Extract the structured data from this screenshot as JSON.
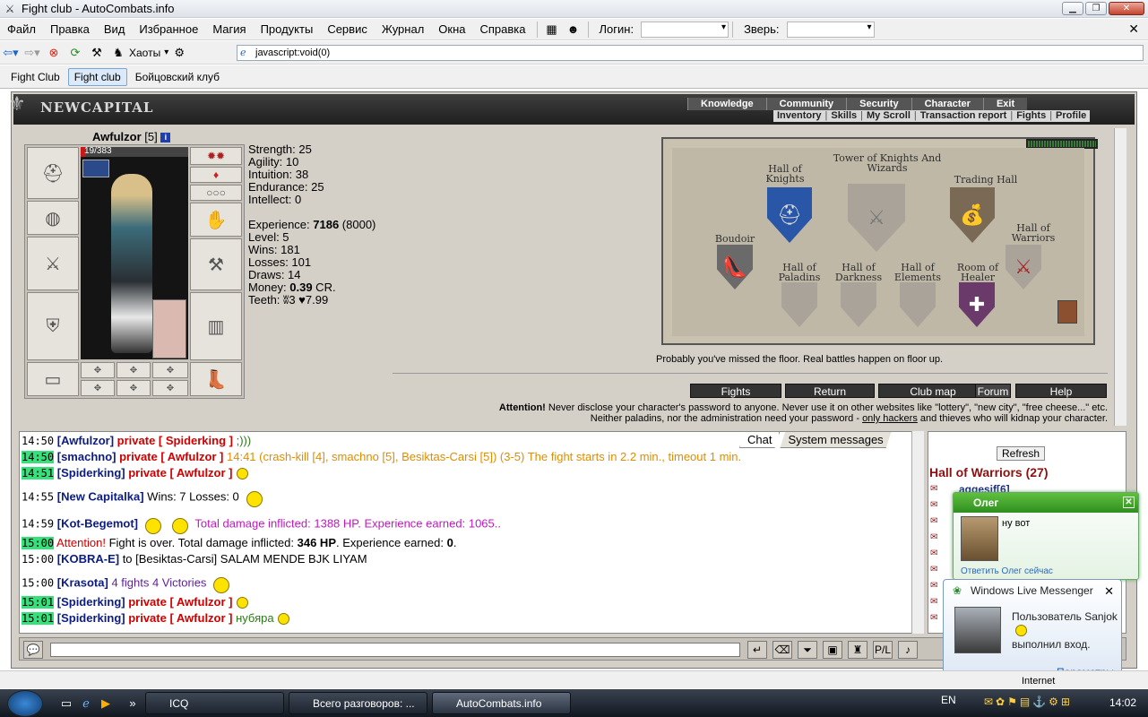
{
  "window": {
    "title": "Fight club - AutoCombats.info"
  },
  "menu": {
    "items": [
      "Файл",
      "Правка",
      "Вид",
      "Избранное",
      "Магия",
      "Продукты",
      "Сервис",
      "Журнал",
      "Окна",
      "Справка"
    ],
    "login_label": "Логин:",
    "pet_label": "Зверь:"
  },
  "toolbar": {
    "haoty": "Хаоты",
    "address": "javascript:void(0)"
  },
  "tabs": [
    "Fight Club",
    "Fight club",
    "Бойцовский клуб"
  ],
  "game": {
    "logo": "NEWCAPITAL",
    "nav_top": [
      "Knowledge",
      "Community",
      "Security",
      "Character",
      "Exit"
    ],
    "nav_bottom": [
      "Inventory",
      "Skills",
      "My Scroll",
      "Transaction report",
      "Fights",
      "Profile"
    ],
    "character": {
      "name": "Awfulzor",
      "level": "[5]",
      "hp_text": "19/383",
      "hp_current": 19,
      "hp_max": 383
    },
    "stats": {
      "strength": "Strength: 25",
      "agility": "Agility: 10",
      "intuition": "Intuition: 38",
      "endurance": "Endurance: 25",
      "intellect": "Intellect: 0",
      "experience_label": "Experience: ",
      "experience_value": "7186",
      "experience_next": " (8000)",
      "level": "Level: 5",
      "wins": "Wins: 181",
      "losses": "Losses: 101",
      "draws": "Draws: 14",
      "money_label": "Money: ",
      "money_value": "0.39",
      "money_unit": " CR.",
      "teeth": "Teeth: ʬ3 ♥7.99"
    },
    "map": {
      "title": "Tower of Knights And Wizards",
      "labels": {
        "hall_knights": "Hall of Knights",
        "trading_hall": "Trading Hall",
        "boudoir": "Boudoir",
        "hall_warriors": "Hall of Warriors",
        "hall_paladins": "Hall of Paladins",
        "hall_darkness": "Hall of Darkness",
        "hall_elements": "Hall of Elements",
        "room_healer": "Room of Healer"
      },
      "note": "Probably you've missed the floor. Real battles happen on floor up."
    },
    "buttons": {
      "fights": "Fights",
      "return": "Return",
      "club_map": "Club map",
      "forum": "Forum",
      "help": "Help"
    },
    "attention": {
      "label": "Attention!",
      "line1": " Never disclose your character's password to anyone. Never use it on other websites like \"lottery\", \"new city\", \"free cheese...\" etc.",
      "line2a": "Neither paladins, nor the administration need your password - ",
      "line2link": "only hackers",
      "line2b": " and thieves who will kidnap your character."
    },
    "chat_tabs": {
      "chat": "Chat",
      "system": "System messages"
    },
    "chat": [
      {
        "time": "14:50",
        "hl": false,
        "name": "[Awfulzor]",
        "parts": [
          [
            "pv",
            " private [ Spiderking ]"
          ],
          [
            "gr",
            " ;)))"
          ]
        ]
      },
      {
        "time": "14:50",
        "hl": true,
        "name": "[smachno]",
        "parts": [
          [
            "pv",
            " private [ Awfulzor ]"
          ],
          [
            "or",
            " 14:41 (crash-kill [4], smachno [5], Besiktas-Carsi [5]) (3-5) The fight starts in 2.2 min., timeout 1 min."
          ]
        ]
      },
      {
        "time": "14:51",
        "hl": true,
        "name": "[Spiderking]",
        "parts": [
          [
            "pv",
            " private [ Awfulzor ]"
          ]
        ],
        "smile": true
      },
      {
        "time": "14:55",
        "hl": false,
        "name": "[New Capitalka]",
        "parts": [
          [
            "",
            " Wins: 7 Losses: 0"
          ]
        ],
        "bigsmile": true
      },
      {
        "time": "14:59",
        "hl": false,
        "name": "[Kot-Begemot]",
        "parts": [
          [
            "mg",
            " Total damage inflicted: 1388 HP. Experience earned: 1065.."
          ]
        ],
        "bigsmile2": true
      },
      {
        "time": "15:00",
        "hl": true,
        "name": "",
        "parts": [
          [
            "rd",
            "Attention!"
          ],
          [
            "",
            " Fight is over. Total damage inflicted: "
          ],
          [
            "b",
            "346 HP"
          ],
          [
            "",
            ". Experience earned: "
          ],
          [
            "b",
            "0"
          ],
          [
            "",
            "."
          ]
        ]
      },
      {
        "time": "15:00",
        "hl": false,
        "name": "[KOBRA-E]",
        "parts": [
          [
            "",
            " to [Besiktas-Carsi] SALAM MENDE BJK LIYAM"
          ]
        ]
      },
      {
        "time": "15:00",
        "hl": false,
        "name": "[Krasota]",
        "parts": [
          [
            "pu",
            " 4 fights 4 Victories"
          ]
        ],
        "bigsmile": true
      },
      {
        "time": "15:01",
        "hl": true,
        "name": "[Spiderking]",
        "parts": [
          [
            "pv",
            " private [ Awfulzor ]"
          ]
        ],
        "smile": true
      },
      {
        "time": "15:01",
        "hl": true,
        "name": "[Spiderking]",
        "parts": [
          [
            "pv",
            " private [ Awfulzor ]"
          ],
          [
            "gr",
            " нубяра"
          ]
        ],
        "smile": true
      }
    ],
    "room": {
      "refresh": "Refresh",
      "title": "Hall of Warriors (27)",
      "first_user": "aggesif[6]"
    }
  },
  "popups": {
    "icq": {
      "name": "Олег",
      "message": "ну вот",
      "reply": "Ответить Олег сейчас"
    },
    "wlm": {
      "title": "Windows Live Messenger",
      "line1": "Пользователь Sanjok",
      "line2": "выполнил вход.",
      "params": "Параметры"
    }
  },
  "status": {
    "zone": "Internet"
  },
  "taskbar": {
    "tasks": [
      "ICQ",
      "Всего разговоров: ...",
      "AutoCombats.info"
    ],
    "lang": "EN",
    "clock": "14:02"
  }
}
